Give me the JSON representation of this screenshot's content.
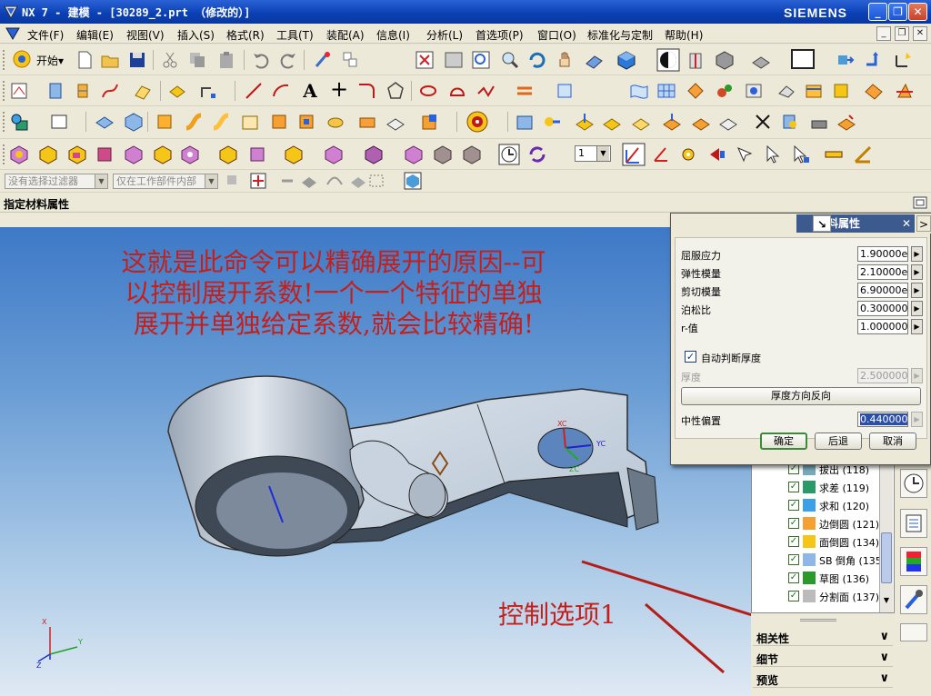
{
  "window": {
    "title": "NX 7 - 建模 - [30289_2.prt （修改的）]",
    "brand": "SIEMENS",
    "min": "_",
    "max": "❐",
    "close": "✕"
  },
  "menu": [
    "文件(F)",
    "编辑(E)",
    "视图(V)",
    "插入(S)",
    "格式(R)",
    "工具(T)",
    "装配(A)",
    "信息(I)",
    "分析(L)",
    "首选项(P)",
    "窗口(O)",
    "标准化与定制",
    "帮助(H)"
  ],
  "toolbar": {
    "start_label": "开始▾",
    "text_tool": "A",
    "plus_tool": "+",
    "layer_value": "1"
  },
  "filters": {
    "type_filter": "没有选择过滤器",
    "scope_filter": "仅在工作部件内部"
  },
  "cue_line": "指定材料属性",
  "annotations": {
    "main_line1": "这就是此命令可以精确展开的原因--可",
    "main_line2": "以控制展开系数!一个一个特征的单独",
    "main_line3": "展开并单独给定系数,就会比较精确!",
    "control": "控制选项1"
  },
  "model_labels": {
    "xc": "XC",
    "yc": "YC",
    "zc": "ZC",
    "x": "X",
    "y": "Y",
    "z": "Z"
  },
  "dialog": {
    "title": "材料属性",
    "close": "✕",
    "properties": [
      {
        "label": "屈服应力",
        "value": "1.90000e"
      },
      {
        "label": "弹性模量",
        "value": "2.10000e"
      },
      {
        "label": "剪切模量",
        "value": "6.90000e"
      },
      {
        "label": "泊松比",
        "value": "0.300000"
      },
      {
        "label": "r-值",
        "value": "1.000000"
      }
    ],
    "auto_thickness_label": "自动判断厚度",
    "thickness_label": "厚度",
    "thickness_value": "2.500000",
    "reverse_button": "厚度方向反向",
    "neutral_label": "中性偏置",
    "neutral_value": "0.440000",
    "ok": "确定",
    "back": "后退",
    "cancel": "取消"
  },
  "navigator": {
    "rows": [
      {
        "label": "拔出 (118)"
      },
      {
        "label": "求差 (119)"
      },
      {
        "label": "求和 (120)"
      },
      {
        "label": "边倒圆 (121)"
      },
      {
        "label": "面倒圆 (134)"
      },
      {
        "label": "SB 倒角 (135)"
      },
      {
        "label": "草图 (136)"
      },
      {
        "label": "分割面 (137)"
      }
    ],
    "sections": [
      "相关性",
      "细节",
      "预览"
    ]
  },
  "colors": {
    "annotation": "#c4201b",
    "titlebar": "#0a3fb3",
    "dialog_title": "#3d5a8e"
  }
}
